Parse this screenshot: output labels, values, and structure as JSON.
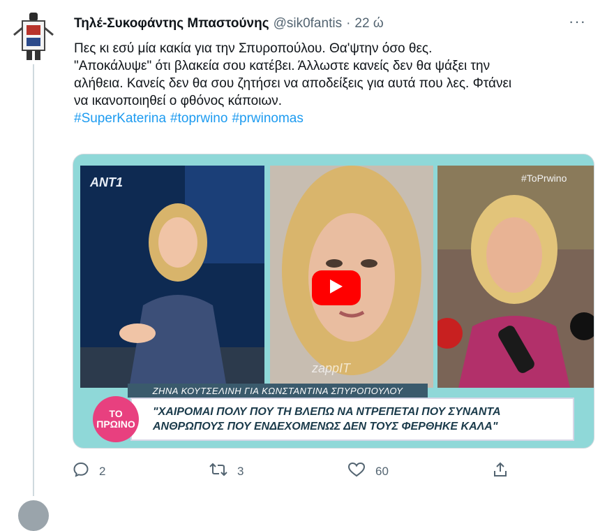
{
  "tweet": {
    "author_name": "Τηλέ-Συκοφάντης Μπαστούνης",
    "handle": "@sik0fantis",
    "separator": "·",
    "time": "22 ώ",
    "more_label": "···",
    "text_lines": [
      "Πες κι εσύ μία κακία για την Σπυροπούλου. Θα'ψτην όσο θες.",
      "\"Αποκάλυψε\" ότι βλακεία σου κατέβει. Άλλωστε κανείς δεν θα ψάξει την",
      "αλήθεια. Κανείς δεν θα σου ζητήσει να αποδείξεις για αυτά που λες. Φτάνει",
      "να ικανοποιηθεί ο φθόνος κάποιων."
    ],
    "hashtags": [
      "#SuperKaterina",
      "#toprwino",
      "#prwinomas"
    ]
  },
  "media": {
    "channel_logo": "ANT1",
    "hashtag_overlay": "#ToPrwino",
    "watermark": "zappIT",
    "subtitle": "ΖΗΝΑ ΚΟΥΤΣΕΛΙΝΗ ΓΙΑ ΚΩΝΣΤΑΝΤΙΝΑ ΣΠΥΡΟΠΟΥΛΟΥ",
    "quote_line1": "\"ΧΑΙΡΟΜΑΙ ΠΟΛΥ ΠΟΥ ΤΗ ΒΛΕΠΩ ΝΑ ΝΤΡΕΠΕΤΑΙ ΠΟΥ ΣΥΝΑΝΤΑ",
    "quote_line2": "ΑΝΘΡΩΠΟΥΣ ΠΟΥ ΕΝΔΕΧΟΜΕΝΩΣ ΔΕΝ ΤΟΥΣ ΦΕΡΘΗΚΕ ΚΑΛΑ\"",
    "show_logo": "ΤΟ ΠΡΩΙΝΟ"
  },
  "actions": {
    "reply_count": "2",
    "retweet_count": "3",
    "like_count": "60"
  },
  "colors": {
    "link": "#1d9bf0",
    "muted": "#536471",
    "play_button": "#ff0000"
  }
}
